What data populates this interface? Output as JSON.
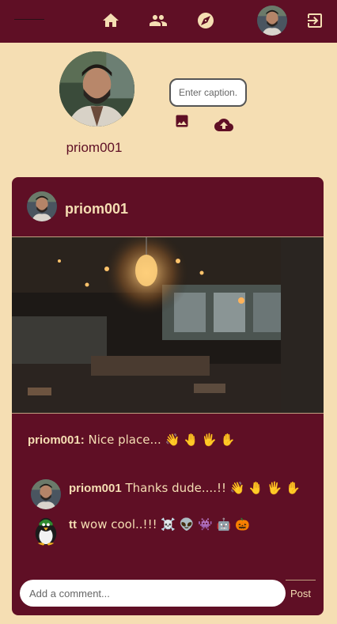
{
  "nav": {
    "icons": [
      "home-icon",
      "people-icon",
      "explore-icon",
      "user-avatar",
      "logout-icon"
    ]
  },
  "profile": {
    "username": "priom001",
    "caption_placeholder": "Enter caption..."
  },
  "post": {
    "author": "priom001",
    "caption_user": "priom001:",
    "caption_text": " Nice place... 👋 🤚 🖐 ✋",
    "comments": [
      {
        "user": "priom001",
        "text": " Thanks dude....!! 👋 🤚 🖐 ✋"
      },
      {
        "user": "tt",
        "text": " wow cool..!!! ☠️ 👽 👾 🤖 🎃"
      }
    ],
    "comment_placeholder": "Add a comment...",
    "post_label": "Post"
  },
  "colors": {
    "primary": "#5f0f25",
    "background": "#f5deb3"
  }
}
